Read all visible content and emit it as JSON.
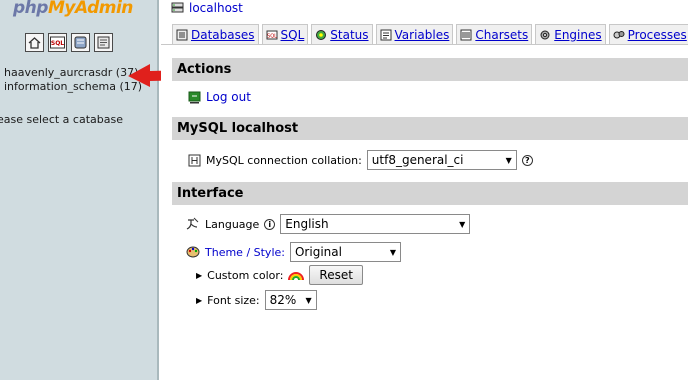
{
  "left": {
    "logo_php": "php",
    "logo_myadmin": "MyAdmin",
    "icons": [
      "home-icon",
      "sql-icon",
      "query-window-icon",
      "docs-icon"
    ],
    "databases": [
      "haavenly_aurcrasdr (37)",
      "information_schema (17)"
    ],
    "select_hint": "ease select a catabase"
  },
  "header": {
    "server": "localhost"
  },
  "tabs": [
    {
      "label": "Databases",
      "icon": "databases-icon"
    },
    {
      "label": "SQL",
      "icon": "sql-icon"
    },
    {
      "label": "Status",
      "icon": "status-icon"
    },
    {
      "label": "Variables",
      "icon": "variables-icon"
    },
    {
      "label": "Charsets",
      "icon": "charsets-icon"
    },
    {
      "label": "Engines",
      "icon": "engines-icon"
    },
    {
      "label": "Processes",
      "icon": "processes-icon"
    }
  ],
  "actions": {
    "title": "Actions",
    "logout": "Log out"
  },
  "mysql": {
    "title": "MySQL localhost",
    "collation_label": "MySQL connection collation:",
    "collation_value": "utf8_general_ci"
  },
  "interface": {
    "title": "Interface",
    "language_label": "Language",
    "language_value": "English",
    "theme_label": "Theme / Style:",
    "theme_value": "Original",
    "custom_color_label": "Custom color:",
    "reset_label": "Reset",
    "font_size_label": "Font size:",
    "font_size_value": "82%"
  },
  "colors": {
    "left_bg": "#d0dce0",
    "link": "#0000cc",
    "section_head": "#d4d4d4",
    "annotation_arrow": "#e0201c"
  }
}
